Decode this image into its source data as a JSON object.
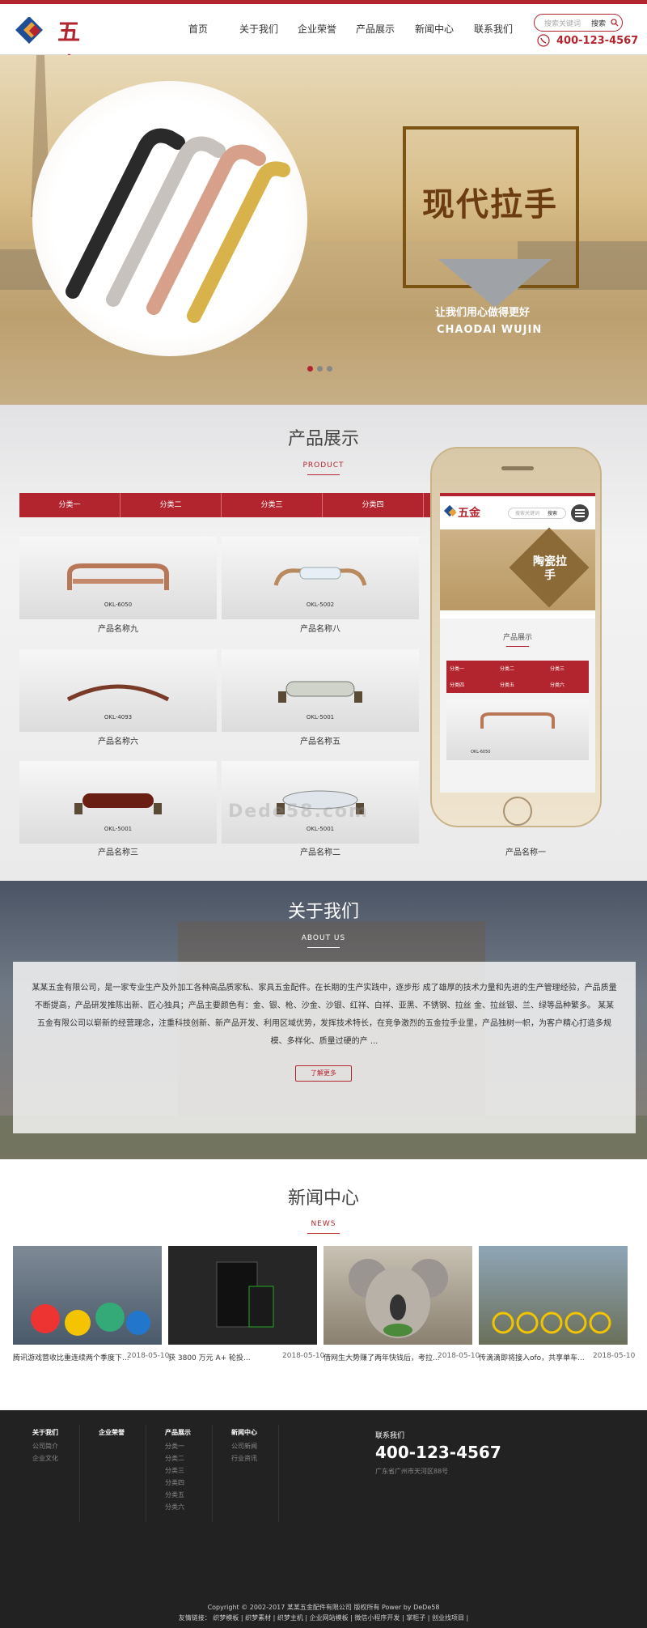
{
  "brand": {
    "name": "五金",
    "accent": "#b3252e"
  },
  "nav": [
    "首页",
    "关于我们",
    "企业荣誉",
    "产品展示",
    "新闻中心",
    "联系我们"
  ],
  "search": {
    "placeholder": "搜索关键词",
    "button": "搜索"
  },
  "hotline": "400-123-4567",
  "banner": {
    "title": "现代拉手",
    "slogan": "让我们用心做得更好",
    "slogan_en": "CHAODAI WUJIN",
    "slides": 3
  },
  "products": {
    "title": "产品展示",
    "subtitle": "PRODUCT",
    "tabs": [
      "分类一",
      "分类二",
      "分类三",
      "分类四"
    ],
    "items": [
      {
        "code": "OKL-6050",
        "name": "产品名称九"
      },
      {
        "code": "OKL-5002",
        "name": "产品名称八"
      },
      {
        "code": "OKL-4093",
        "name": "产品名称六"
      },
      {
        "code": "OKL-5001",
        "name": "产品名称五"
      },
      {
        "code": "OKL-5001",
        "name": "产品名称三"
      },
      {
        "code": "OKL-5001",
        "name": "产品名称二"
      }
    ],
    "extra_name": "产品名称一"
  },
  "mobile": {
    "logo": "五金",
    "search_placeholder": "搜索关键词",
    "search_button": "搜索",
    "banner_title": "陶瓷拉手",
    "section_title": "产品展示",
    "tabs": [
      "分类一",
      "分类二",
      "分类三",
      "分类四",
      "分类五",
      "分类六"
    ],
    "product_code": "OKL-6050"
  },
  "watermark": "Dede58.com",
  "about": {
    "title": "关于我们",
    "subtitle": "ABOUT US",
    "text": "某某五金有限公司，是一家专业生产及外加工各种高品质家私、家具五金配件。在长期的生产实践中，逐步形 成了雄厚的技术力量和先进的生产管理经验，产品质量不断提高，产品研发推陈出新、匠心独具；产品主要颜色有：金、银、枪、沙金、沙银、红祥、白祥、亚黑、不锈钢、拉丝 金、拉丝银、兰、绿等品种繁多。 某某五金有限公司以崭新的经营理念，注重科技创新、新产品开发、利用区域优势，发挥技术特长，在竞争激烈的五金拉手业里，产品独树一帜，为客户精心打造多规模、多样化、质量过硬的产 ...",
    "more": "了解更多"
  },
  "news": {
    "title": "新闻中心",
    "subtitle": "NEWS",
    "items": [
      {
        "title": "腾讯游戏营收比重连续两个季度下...",
        "date": "2018-05-10"
      },
      {
        "title": "获 3800 万元 A+ 轮投...",
        "date": "2018-05-10"
      },
      {
        "title": "借网生大势赚了两年快钱后，考拉...",
        "date": "2018-05-10"
      },
      {
        "title": "传滴滴即将接入ofo，共享单车...",
        "date": "2018-05-10"
      }
    ]
  },
  "footer": {
    "columns": [
      {
        "title": "关于我们",
        "links": [
          "公司简介",
          "企业文化"
        ]
      },
      {
        "title": "企业荣誉",
        "links": []
      },
      {
        "title": "产品展示",
        "links": [
          "分类一",
          "分类二",
          "分类三",
          "分类四",
          "分类五",
          "分类六"
        ]
      },
      {
        "title": "新闻中心",
        "links": [
          "公司新闻",
          "行业资讯"
        ]
      }
    ],
    "contact_title": "联系我们",
    "phone": "400-123-4567",
    "address": "广东省广州市天河区88号",
    "copyright": "Copyright © 2002-2017 某某五金配件有限公司 版权所有 Power by DeDe58",
    "links": "友情链接： 织梦模板 | 织梦素材 | 织梦主机 | 企业网站模板 | 微信小程序开发 | 掌柜子 | 创业找项目 |"
  }
}
